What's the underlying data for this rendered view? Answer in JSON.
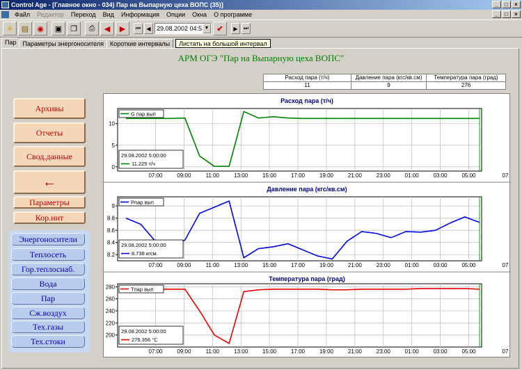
{
  "window": {
    "title": "Control Age - [Главное окно - 034) Пар на Выпарную цеха ВОПС (35)]",
    "minimize": "_",
    "maximize": "□",
    "close": "×"
  },
  "menu": [
    {
      "label": "Файл",
      "disabled": false
    },
    {
      "label": "Редактор",
      "disabled": true
    },
    {
      "label": "Переход",
      "disabled": false
    },
    {
      "label": "Вид",
      "disabled": false
    },
    {
      "label": "Информация",
      "disabled": false
    },
    {
      "label": "Опции",
      "disabled": false
    },
    {
      "label": "Окна",
      "disabled": false
    },
    {
      "label": "О программе",
      "disabled": false
    }
  ],
  "toolbar": {
    "datetime": "29.08.2002 04:53"
  },
  "tabs": {
    "tab1": "Пар",
    "tab2": "Параметры энергоносителя",
    "tab3": "Короткие интервалы",
    "tooltip": "Листать на большой интервал"
  },
  "app_title": "АРМ ОГЭ   \"Пар на Выпарную цеха ВОПС\"",
  "summary": {
    "headers": [
      "Расход пара (т/ч)",
      "Давление пара (кгс/кв.см)",
      "Температура пара (град)"
    ],
    "values": [
      "11",
      "9",
      "276"
    ]
  },
  "left_buttons": {
    "archives": "Архивы",
    "reports": "Отчеты",
    "summary_data": "Свод.данные",
    "back_arrow": "←",
    "parameters": "Параметры",
    "kor_int": "Кор.инт"
  },
  "energy_buttons": {
    "energy": "Энергоносители",
    "heating": "Теплосеть",
    "hot_water": "Гор.теплоснаб.",
    "water": "Вода",
    "steam": "Пар",
    "air": "Сж.воздух",
    "gases": "Тех.газы",
    "drains": "Тех.стоки"
  },
  "chart_data": [
    {
      "type": "line",
      "title": "Расход пара (т/ч)",
      "x": [
        "05:00",
        "06:00",
        "07:00",
        "08:00",
        "09:00",
        "10:00",
        "11:00",
        "12:00",
        "13:00",
        "14:00",
        "15:00",
        "16:00",
        "17:00",
        "18:00",
        "19:00",
        "20:00",
        "21:00",
        "22:00",
        "23:00",
        "00:00",
        "01:00",
        "02:00",
        "03:00",
        "04:00",
        "05:00"
      ],
      "x_tick_labels": [
        "07:00",
        "09:00",
        "11:00",
        "13:00",
        "15:00",
        "17:00",
        "19:00",
        "21:00",
        "23:00",
        "01:00",
        "03:00",
        "05:00",
        "07"
      ],
      "series": [
        {
          "name": "G пар.вып",
          "color": "#008000",
          "values": [
            11.2,
            11.2,
            11.2,
            11.2,
            11.3,
            2.5,
            0.1,
            0.1,
            12.8,
            11.3,
            11.6,
            11.3,
            11.2,
            11.2,
            11.2,
            11.2,
            11.2,
            11.2,
            11.2,
            11.2,
            11.2,
            11.2,
            11.2,
            11.2,
            11.2
          ]
        }
      ],
      "y_ticks": [
        0,
        5,
        10
      ],
      "ylim": [
        -1,
        13.5
      ],
      "cursor_label": "29.08.2002 5:00:00",
      "cursor_value": "11.225 т/ч"
    },
    {
      "type": "line",
      "title": "Давление пара (кгс/кв.см)",
      "x": [
        "05:00",
        "06:00",
        "07:00",
        "08:00",
        "09:00",
        "10:00",
        "11:00",
        "12:00",
        "13:00",
        "14:00",
        "15:00",
        "16:00",
        "17:00",
        "18:00",
        "19:00",
        "20:00",
        "21:00",
        "22:00",
        "23:00",
        "00:00",
        "01:00",
        "02:00",
        "03:00",
        "04:00",
        "05:00"
      ],
      "x_tick_labels": [
        "07:00",
        "09:00",
        "11:00",
        "13:00",
        "15:00",
        "17:00",
        "19:00",
        "21:00",
        "23:00",
        "01:00",
        "03:00",
        "05:00",
        "07"
      ],
      "series": [
        {
          "name": "Pпар вып",
          "color": "#0000e0",
          "values": [
            8.8,
            8.7,
            8.42,
            8.35,
            8.44,
            8.88,
            8.98,
            9.08,
            8.15,
            8.3,
            8.33,
            8.38,
            8.28,
            8.18,
            8.13,
            8.42,
            8.58,
            8.55,
            8.48,
            8.58,
            8.57,
            8.6,
            8.72,
            8.82,
            8.73
          ]
        }
      ],
      "y_ticks": [
        8.2,
        8.4,
        8.6,
        8.8,
        9
      ],
      "ylim": [
        8.1,
        9.15
      ],
      "cursor_label": "29.08.2002 5:00:00",
      "cursor_value": "8.738 кгсм."
    },
    {
      "type": "line",
      "title": "Температура пара (град)",
      "x": [
        "05:00",
        "06:00",
        "07:00",
        "08:00",
        "09:00",
        "10:00",
        "11:00",
        "12:00",
        "13:00",
        "14:00",
        "15:00",
        "16:00",
        "17:00",
        "18:00",
        "19:00",
        "20:00",
        "21:00",
        "22:00",
        "23:00",
        "00:00",
        "01:00",
        "02:00",
        "03:00",
        "04:00",
        "05:00"
      ],
      "x_tick_labels": [
        "07:00",
        "09:00",
        "11:00",
        "13:00",
        "15:00",
        "17:00",
        "19:00",
        "21:00",
        "23:00",
        "01:00",
        "03:00",
        "05:00",
        "07"
      ],
      "series": [
        {
          "name": "Tпар вып",
          "color": "#e00000",
          "values": [
            276,
            276,
            276,
            276,
            276,
            240,
            200,
            186,
            272,
            275,
            276,
            276,
            276,
            276,
            275,
            275,
            276,
            276,
            276,
            276,
            277,
            277,
            277,
            277,
            276
          ]
        }
      ],
      "y_ticks": [
        200,
        220,
        240,
        260,
        280
      ],
      "ylim": [
        180,
        285
      ],
      "cursor_label": "29.08.2002 5:00:00",
      "cursor_value": "276.356 °C"
    }
  ]
}
